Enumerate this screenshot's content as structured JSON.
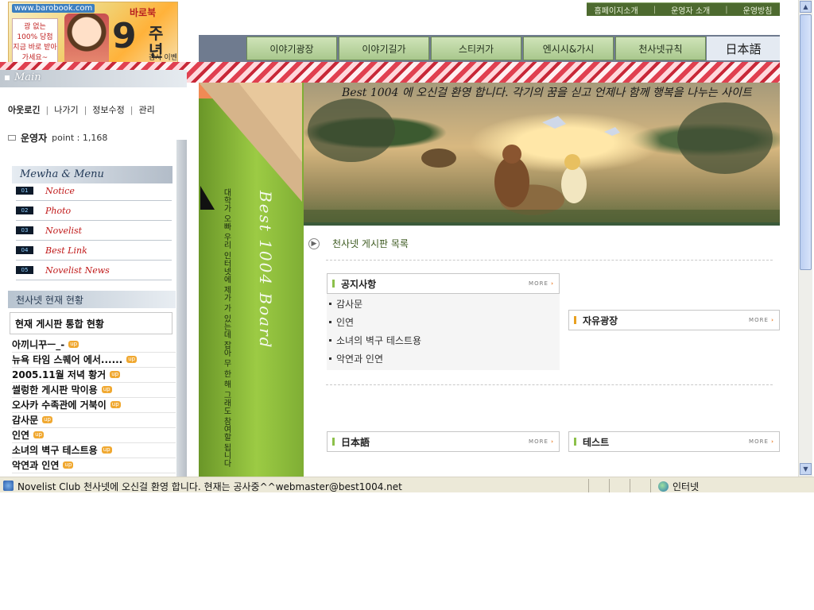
{
  "banner": {
    "url": "www.barobook.com",
    "free_text": "광 없는 100% 당첨 지금 바로 받아가세요~",
    "shop_name": "바로북",
    "anniversary_number": "9",
    "anniversary_word": "주년",
    "event_text": "감사 이벤트"
  },
  "top_links": [
    "홈페이지소개",
    "운영자 소개",
    "운영방침"
  ],
  "top_link_separator": "|",
  "nav": [
    "이야기광장",
    "이야기길가",
    "스티커가",
    "엔시시&가시",
    "천사넷규칙"
  ],
  "nav_language": "日本語",
  "main_tab_label": "Main",
  "login_links": [
    "아웃로긴",
    "나가기",
    "정보수정",
    "관리"
  ],
  "login_separator": "|",
  "user": {
    "name": "운영자",
    "points_label": "point : 1,168"
  },
  "menu": {
    "title": "Mewha & Menu",
    "items": [
      {
        "num": "01",
        "label": "Notice"
      },
      {
        "num": "02",
        "label": "Photo"
      },
      {
        "num": "03",
        "label": "Novelist"
      },
      {
        "num": "04",
        "label": "Best Link"
      },
      {
        "num": "05",
        "label": "Novelist News"
      }
    ]
  },
  "status_section": {
    "title": "천사넷 현재 현황",
    "box_title": "현재 게시판 통합 현황",
    "posts": [
      "아끼니꾸ㅡ_-",
      "뉴욕 타임 스퀘어 에서......",
      "2005.11월 저녁 황거",
      "썰렁한 게시판 막이용",
      "오사카 수족관에 거북이",
      "감사문",
      "인연",
      "소녀의 벽구 테스트용",
      "악연과 인연"
    ],
    "badge": "up"
  },
  "center_banner": {
    "title": "Best 1004 Board",
    "slogan": "대학가 오빠 우리 인터넷에 제가 가 있는데 잡아 무 한 해 그래도 참여할 됩니다"
  },
  "hero": {
    "ticker": "Best 1004 에 오신걸 환영 합니다. 각기의 꿈을 싣고 언제나 함께 행복을 나누는 사이트"
  },
  "board_list": {
    "title": "천사넷 게시판 목록",
    "more_label": "MORE",
    "boxes": [
      {
        "name": "공지사항",
        "items": [
          "감사문",
          "인연",
          "소녀의 벽구 테스트용",
          "악연과 인연"
        ]
      },
      {
        "name": "자유광장",
        "items": []
      },
      {
        "name": "日本語",
        "items": []
      },
      {
        "name": "테스트",
        "items": []
      }
    ]
  },
  "status_bar": {
    "text": "Novelist Club 천사넷에 오신걸 환영 합니다. 현재는 공사중^^webmaster@best1004.net",
    "zone": "인터넷"
  },
  "colors": {
    "nav_green": "#a9c88d",
    "pencil_green": "#9ccb44",
    "menu_red": "#c01818",
    "status_bar": "#ece9d8"
  }
}
